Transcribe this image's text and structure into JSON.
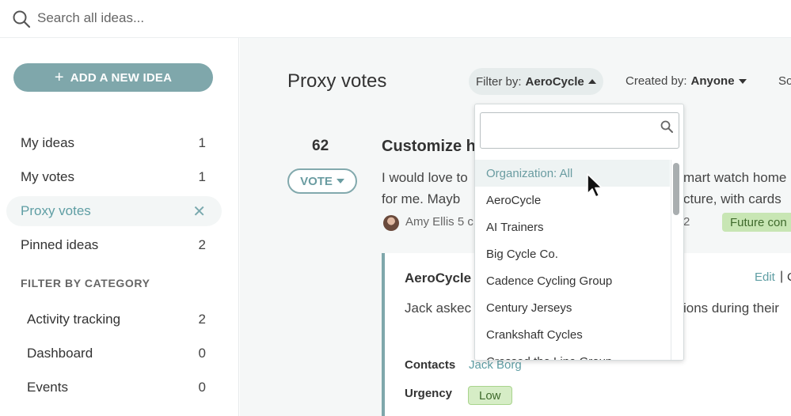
{
  "search": {
    "placeholder": "Search all ideas..."
  },
  "sidebar": {
    "add_button_label": "ADD A NEW IDEA",
    "nav": [
      {
        "label": "My ideas",
        "count": "1"
      },
      {
        "label": "My votes",
        "count": "1"
      },
      {
        "label": "Proxy votes",
        "active": true
      },
      {
        "label": "Pinned ideas",
        "count": "2"
      }
    ],
    "category_title": "FILTER BY CATEGORY",
    "categories": [
      {
        "label": "Activity tracking",
        "count": "2"
      },
      {
        "label": "Dashboard",
        "count": "0"
      },
      {
        "label": "Events",
        "count": "0"
      }
    ]
  },
  "main": {
    "title": "Proxy votes",
    "filter": {
      "prefix": "Filter by:",
      "value": "AeroCycle"
    },
    "created": {
      "prefix": "Created by:",
      "value": "Anyone"
    },
    "sort_cut": "So",
    "idea": {
      "votes": "62",
      "vote_label": "VOTE",
      "title": "Customize h",
      "text_line1": "I would love to",
      "text_line2": "for me. Mayb",
      "text_right1": "mart watch home",
      "text_right2": "cture, with cards",
      "author_meta": "Amy Ellis 5 c",
      "comment_count": "2",
      "tag": "Future con"
    },
    "proxy": {
      "org": "AeroCycle",
      "edit_label": "Edit",
      "edit_sep": "|",
      "edit_c": "C",
      "body_left": "Jack askec",
      "body_right": "ions during their",
      "contacts_label": "Contacts",
      "contacts_value": "Jack Borg",
      "urgency_label": "Urgency",
      "urgency_value": "Low"
    }
  },
  "dropdown": {
    "search_value": "",
    "items": [
      "Organization: All",
      "AeroCycle",
      "AI Trainers",
      "Big Cycle Co.",
      "Cadence Cycling Group",
      "Century Jerseys",
      "Crankshaft Cycles",
      "Crossed the Line Group"
    ]
  },
  "colors": {
    "accent": "#7fa7ab",
    "accent_text": "#5f9ea4",
    "tag_green": "#c8e6b4"
  }
}
